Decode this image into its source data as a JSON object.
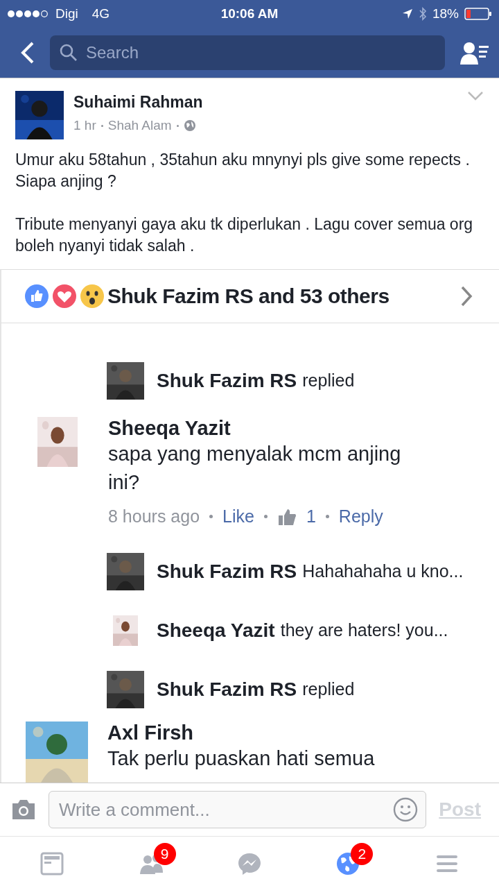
{
  "status_bar": {
    "carrier": "Digi",
    "network": "4G",
    "time": "10:06 AM",
    "battery": "18%"
  },
  "nav": {
    "search": {
      "placeholder": "Search"
    }
  },
  "post": {
    "author": "Suhaimi Rahman",
    "time": "1 hr",
    "location": "Shah Alam",
    "paragraphs": [
      "Umur aku 58tahun , 35tahun aku mnynyi pls give some repects . Siapa anjing ?",
      "Tribute menyanyi gaya aku tk diperlukan . Lagu cover semua org boleh nyanyi tidak salah ."
    ],
    "shared_image": {
      "reactions": "Shuk Fazim RS and 53 others",
      "items": [
        {
          "kind": "reply_summary",
          "name": "Shuk Fazim RS",
          "text": "replied"
        },
        {
          "kind": "comment",
          "name": "Sheeqa Yazit",
          "text": "sapa yang menyalak mcm anjing ini?",
          "time": "8 hours ago",
          "like": "Like",
          "likes": "1",
          "reply": "Reply"
        },
        {
          "kind": "reply_summary",
          "name": "Shuk Fazim RS",
          "text": "Hahahahaha u kno..."
        },
        {
          "kind": "reply_summary",
          "name": "Sheeqa Yazit",
          "text": "they are haters! you..."
        },
        {
          "kind": "reply_summary",
          "name": "Shuk Fazim RS",
          "text": "replied"
        },
        {
          "kind": "comment",
          "name": "Axl Firsh",
          "text": "Tak perlu puaskan hati semua"
        }
      ]
    }
  },
  "composer": {
    "placeholder": "Write a comment...",
    "post_button": "Post",
    "post_disabled": true
  },
  "tabs": [
    {
      "kind": "feed",
      "selected": false
    },
    {
      "kind": "friends",
      "selected": false,
      "badge": "9"
    },
    {
      "kind": "messenger",
      "selected": false
    },
    {
      "kind": "notifications",
      "selected": true,
      "badge": "2"
    },
    {
      "kind": "menu",
      "selected": false
    }
  ]
}
